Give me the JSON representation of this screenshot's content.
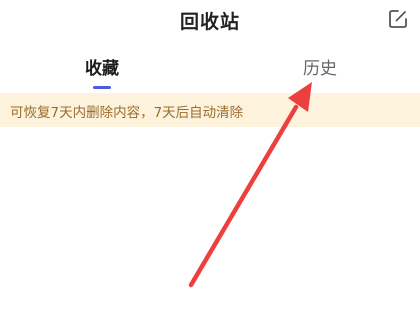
{
  "header": {
    "title": "回收站",
    "edit_icon": "edit-icon"
  },
  "tabs": [
    {
      "label": "收藏",
      "active": true
    },
    {
      "label": "历史",
      "active": false
    }
  ],
  "notice": {
    "text": "可恢复7天内删除内容，7天后自动清除"
  },
  "colors": {
    "accent": "#4a5bdc",
    "notice_bg": "#fdf3dc",
    "notice_text": "#9a6d2e",
    "annotation_arrow": "#ee3f3f"
  }
}
